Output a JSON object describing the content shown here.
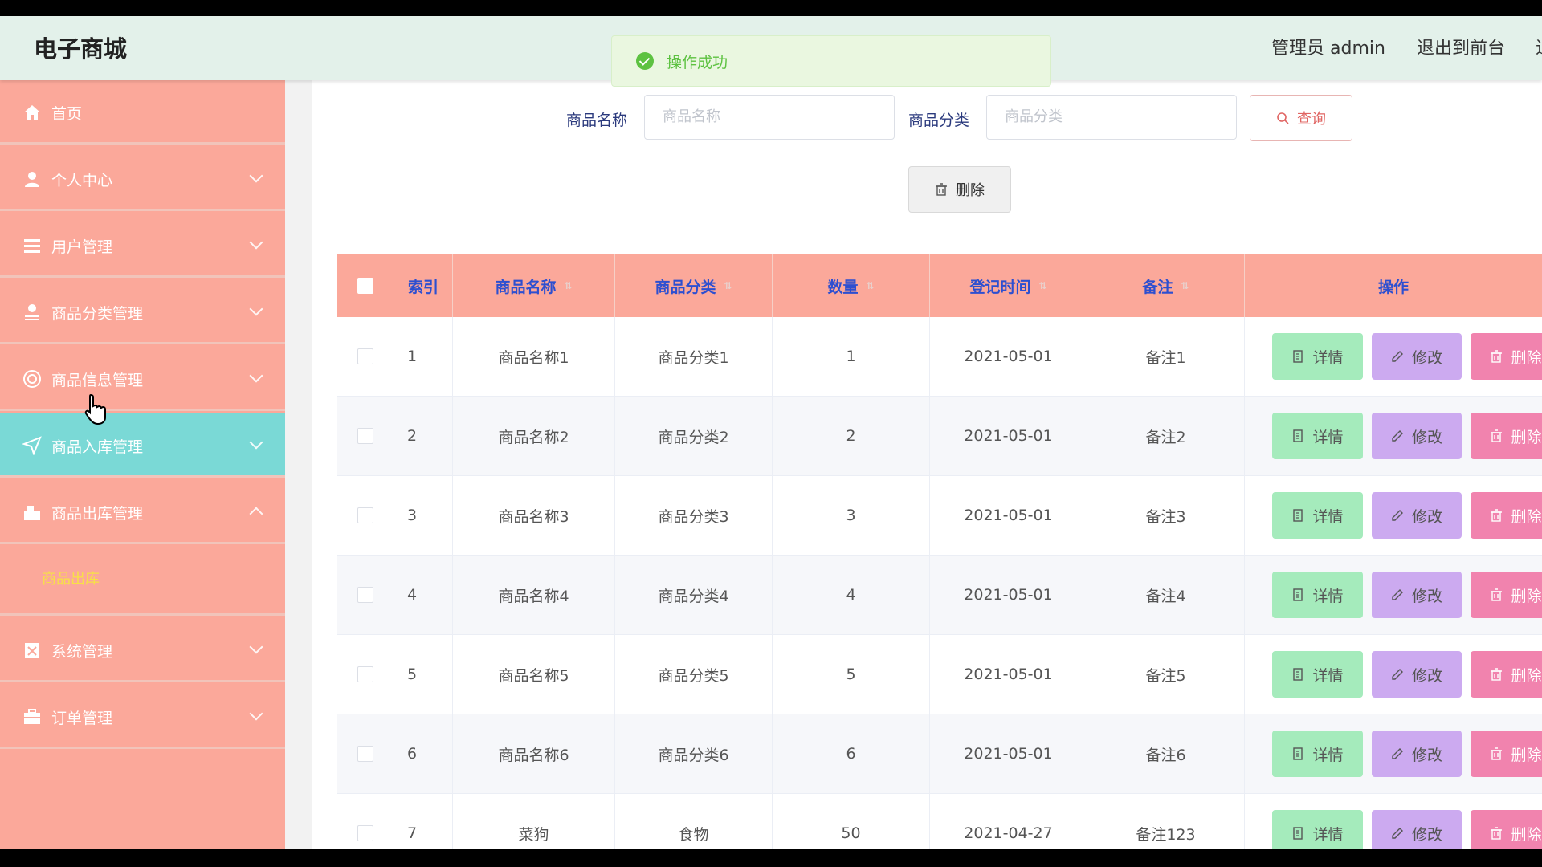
{
  "header": {
    "brand": "电子商城",
    "links": [
      {
        "label": "管理员 admin"
      },
      {
        "label": "退出到前台"
      },
      {
        "label": "退"
      }
    ]
  },
  "toast": {
    "message": "操作成功"
  },
  "sidebar": {
    "items": [
      {
        "label": "首页",
        "icon": "home-icon"
      },
      {
        "label": "个人中心",
        "icon": "user-icon"
      },
      {
        "label": "用户管理",
        "icon": "list-icon"
      },
      {
        "label": "商品分类管理",
        "icon": "user-icon"
      },
      {
        "label": "商品信息管理",
        "icon": "target-icon"
      },
      {
        "label": "商品入库管理",
        "icon": "send-icon",
        "active": true
      },
      {
        "label": "商品出库管理",
        "icon": "box-icon",
        "expanded": true
      },
      {
        "label": "系统管理",
        "icon": "clipboard-icon"
      },
      {
        "label": "订单管理",
        "icon": "briefcase-icon"
      }
    ],
    "subitems": [
      {
        "label": "商品出库"
      }
    ]
  },
  "search": {
    "name_label": "商品名称",
    "name_placeholder": "商品名称",
    "category_label": "商品分类",
    "category_placeholder": "商品分类",
    "query_label": "查询",
    "delete_label": "删除"
  },
  "table": {
    "columns": [
      "索引",
      "商品名称",
      "商品分类",
      "数量",
      "登记时间",
      "备注",
      "操作"
    ],
    "rows": [
      {
        "index": "1",
        "name": "商品名称1",
        "category": "商品分类1",
        "qty": "1",
        "date": "2021-05-01",
        "note": "备注1"
      },
      {
        "index": "2",
        "name": "商品名称2",
        "category": "商品分类2",
        "qty": "2",
        "date": "2021-05-01",
        "note": "备注2"
      },
      {
        "index": "3",
        "name": "商品名称3",
        "category": "商品分类3",
        "qty": "3",
        "date": "2021-05-01",
        "note": "备注3"
      },
      {
        "index": "4",
        "name": "商品名称4",
        "category": "商品分类4",
        "qty": "4",
        "date": "2021-05-01",
        "note": "备注4"
      },
      {
        "index": "5",
        "name": "商品名称5",
        "category": "商品分类5",
        "qty": "5",
        "date": "2021-05-01",
        "note": "备注5"
      },
      {
        "index": "6",
        "name": "商品名称6",
        "category": "商品分类6",
        "qty": "6",
        "date": "2021-05-01",
        "note": "备注6"
      },
      {
        "index": "7",
        "name": "菜狗",
        "category": "食物",
        "qty": "50",
        "date": "2021-04-27",
        "note": "备注123"
      }
    ],
    "actions": {
      "detail": "详情",
      "edit": "修改",
      "delete": "删除"
    }
  },
  "colors": {
    "sidebar_bg": "#fba89a",
    "sidebar_active": "#7ad9d6",
    "header_bg": "#e3f1ea",
    "btn_detail": "#a5ebbc",
    "btn_edit": "#ccaaf0",
    "btn_delete": "#f183ae"
  }
}
